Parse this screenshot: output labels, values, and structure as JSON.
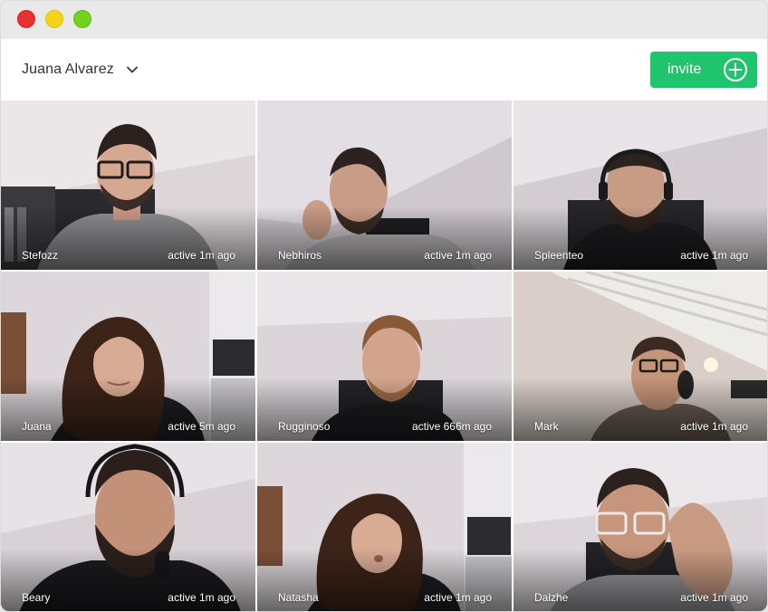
{
  "window": {
    "controls": [
      "close",
      "minimize",
      "zoom"
    ]
  },
  "header": {
    "user_name": "Juana Alvarez",
    "invite_label": "invite"
  },
  "participants": [
    {
      "name": "Stefozz",
      "status": "active 1m ago"
    },
    {
      "name": "Nebhiros",
      "status": "active 1m ago"
    },
    {
      "name": "Spleenteo",
      "status": "active 1m ago"
    },
    {
      "name": "Juana",
      "status": "active 5m ago"
    },
    {
      "name": "Rugginoso",
      "status": "active 666m ago"
    },
    {
      "name": "Mark",
      "status": "active 1m ago"
    },
    {
      "name": "Beary",
      "status": "active 1m ago"
    },
    {
      "name": "Natasha",
      "status": "active 1m ago"
    },
    {
      "name": "Dalzhe",
      "status": "active 1m ago"
    }
  ],
  "colors": {
    "invite_button": "#20c46c",
    "close": "#ea2f2f",
    "minimize": "#f4d417",
    "zoom": "#74d11c"
  },
  "icons": {
    "user_menu": "chevron-down-icon",
    "invite": "plus-circle-icon"
  }
}
